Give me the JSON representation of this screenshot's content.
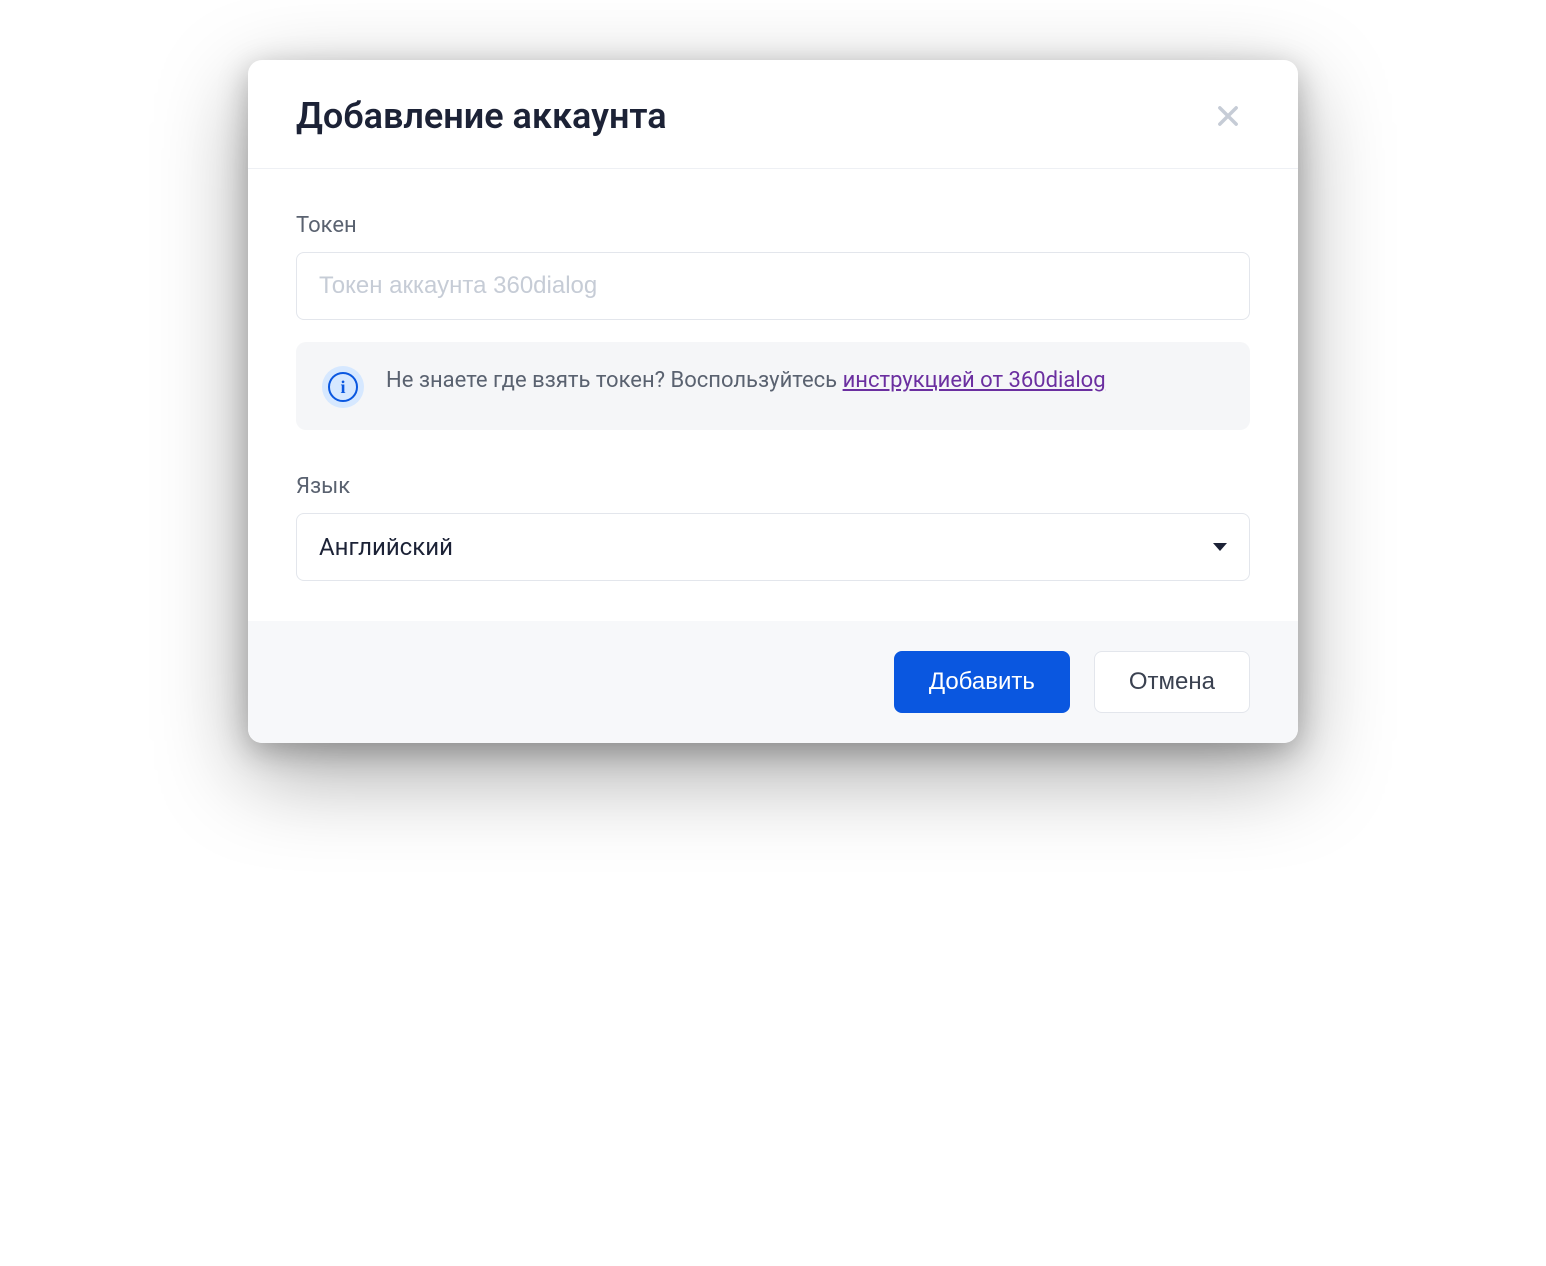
{
  "modal": {
    "title": "Добавление аккаунта"
  },
  "token": {
    "label": "Токен",
    "placeholder": "Токен аккаунта 360dialog",
    "value": ""
  },
  "info": {
    "text_prefix": "Не знаете где взять токен? Воспользуйтесь ",
    "link_text": "инструкцией от 360dialog"
  },
  "language": {
    "label": "Язык",
    "selected": "Английский"
  },
  "footer": {
    "primary": "Добавить",
    "secondary": "Отмена"
  }
}
